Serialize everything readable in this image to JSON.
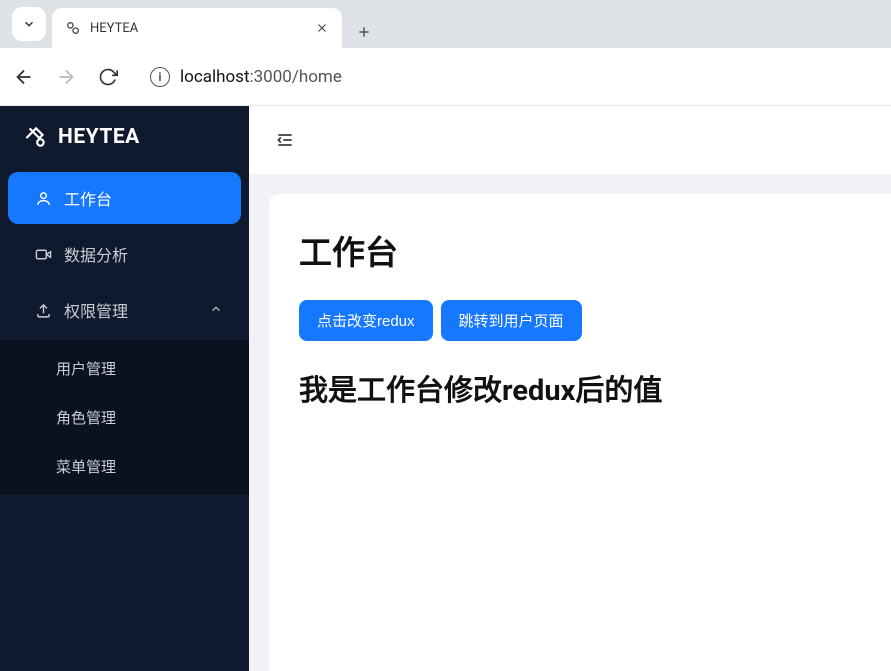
{
  "browser": {
    "tab_title": "HEYTEA",
    "url_host": "localhost",
    "url_port_path": ":3000/home"
  },
  "sidebar": {
    "brand": "HEYTEA",
    "items": [
      {
        "label": "工作台",
        "icon": "user-icon",
        "active": true
      },
      {
        "label": "数据分析",
        "icon": "video-icon"
      },
      {
        "label": "权限管理",
        "icon": "upload-icon",
        "expanded": true
      }
    ],
    "submenu": [
      {
        "label": "用户管理"
      },
      {
        "label": "角色管理"
      },
      {
        "label": "菜单管理"
      }
    ]
  },
  "main": {
    "title": "工作台",
    "button1": "点击改变redux",
    "button2": "跳转到用户页面",
    "subheading": "我是工作台修改redux后的值"
  }
}
